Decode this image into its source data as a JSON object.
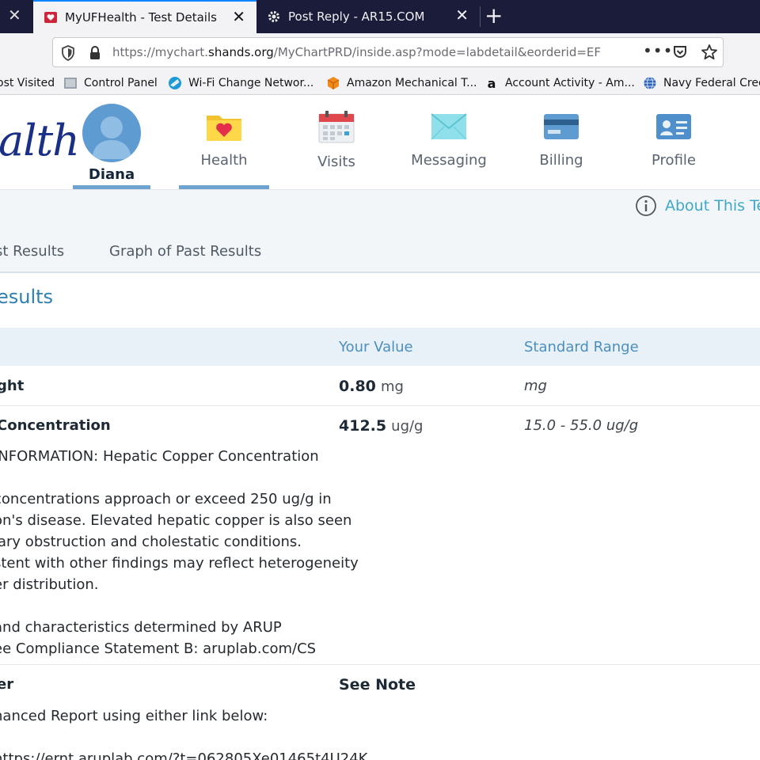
{
  "browser": {
    "tabs": [
      {
        "label": "MyUFHealth - Test Details",
        "active": true,
        "favicon": "myufhealth-icon"
      },
      {
        "label": "Post Reply - AR15.COM",
        "active": false,
        "favicon": "gear-icon"
      }
    ],
    "url": {
      "prefix": "https://mychart.",
      "domain": "shands.org",
      "path": "/MyChartPRD/inside.asp?mode=labdetail&eorderid=EF"
    },
    "bookmarks": [
      {
        "label": "ost Visited",
        "icon": "none"
      },
      {
        "label": "Control Panel",
        "icon": "control-panel-icon"
      },
      {
        "label": "Wi-Fi Change Networ...",
        "icon": "wifi-icon"
      },
      {
        "label": "Amazon Mechanical T...",
        "icon": "amazon-box-icon"
      },
      {
        "label": "Account Activity - Am...",
        "icon": "amazon-icon"
      },
      {
        "label": "Navy Federal Cred",
        "icon": "globe-icon"
      }
    ]
  },
  "header": {
    "logo_text": "alth",
    "user_name": "Diana",
    "nav": [
      {
        "label": "Health",
        "icon": "folder-heart-icon",
        "active": true
      },
      {
        "label": "Visits",
        "icon": "calendar-icon",
        "active": false
      },
      {
        "label": "Messaging",
        "icon": "envelope-icon",
        "active": false
      },
      {
        "label": "Billing",
        "icon": "credit-card-icon",
        "active": false
      },
      {
        "label": "Profile",
        "icon": "id-card-icon",
        "active": false
      }
    ]
  },
  "page": {
    "about_link": "About This Te",
    "subtabs": [
      "st Results",
      "Graph of Past Results"
    ],
    "section_title": "esults",
    "table": {
      "columns": [
        "Your Value",
        "Standard Range"
      ],
      "rows": [
        {
          "name": "ght",
          "value": "0.80",
          "unit": "mg",
          "range": "mg"
        },
        {
          "name": "Concentration",
          "value": "412.5",
          "unit": "ug/g",
          "range": "15.0 - 55.0 ug/g",
          "notes": [
            "INFORMATION: Hepatic Copper Concentration",
            "",
            "concentrations approach or exceed 250 ug/g in",
            "on's disease. Elevated hepatic copper is also seen",
            "iary obstruction and cholestatic conditions.",
            "stent with other findings may reflect heterogeneity",
            "er distribution.",
            "",
            "and characteristics determined by ARUP",
            "ee Compliance Statement B: aruplab.com/CS"
          ]
        },
        {
          "name": "er",
          "value": "See Note",
          "unit": "",
          "range": "",
          "notes": [
            "hanced Report using either link below:",
            "",
            "https://ernt.aruplab.com/?t=062805Xe01465t4U24K"
          ]
        }
      ]
    }
  }
}
